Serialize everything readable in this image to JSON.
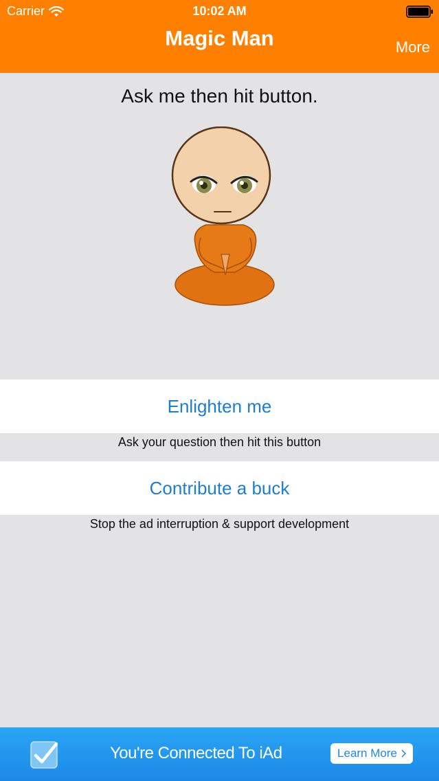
{
  "status_bar": {
    "carrier": "Carrier",
    "time": "10:02 AM"
  },
  "nav": {
    "title": "Magic Man",
    "more_label": "More"
  },
  "main": {
    "prompt": "Ask me then hit button.",
    "enlighten_label": "Enlighten me",
    "enlighten_caption": "Ask your question then hit this button",
    "contribute_label": "Contribute a buck",
    "contribute_caption": "Stop the ad interruption & support development"
  },
  "ad": {
    "text": "You're Connected To iAd",
    "learn_more_label": "Learn More"
  },
  "colors": {
    "nav_bar": "#ff8000",
    "link": "#1a7fd4",
    "background": "#e3e3e5",
    "ad_banner": "#1c89e6"
  },
  "icons": [
    "wifi-icon",
    "battery-icon",
    "monk-illustration",
    "checkmark-icon",
    "chevron-right-icon"
  ]
}
